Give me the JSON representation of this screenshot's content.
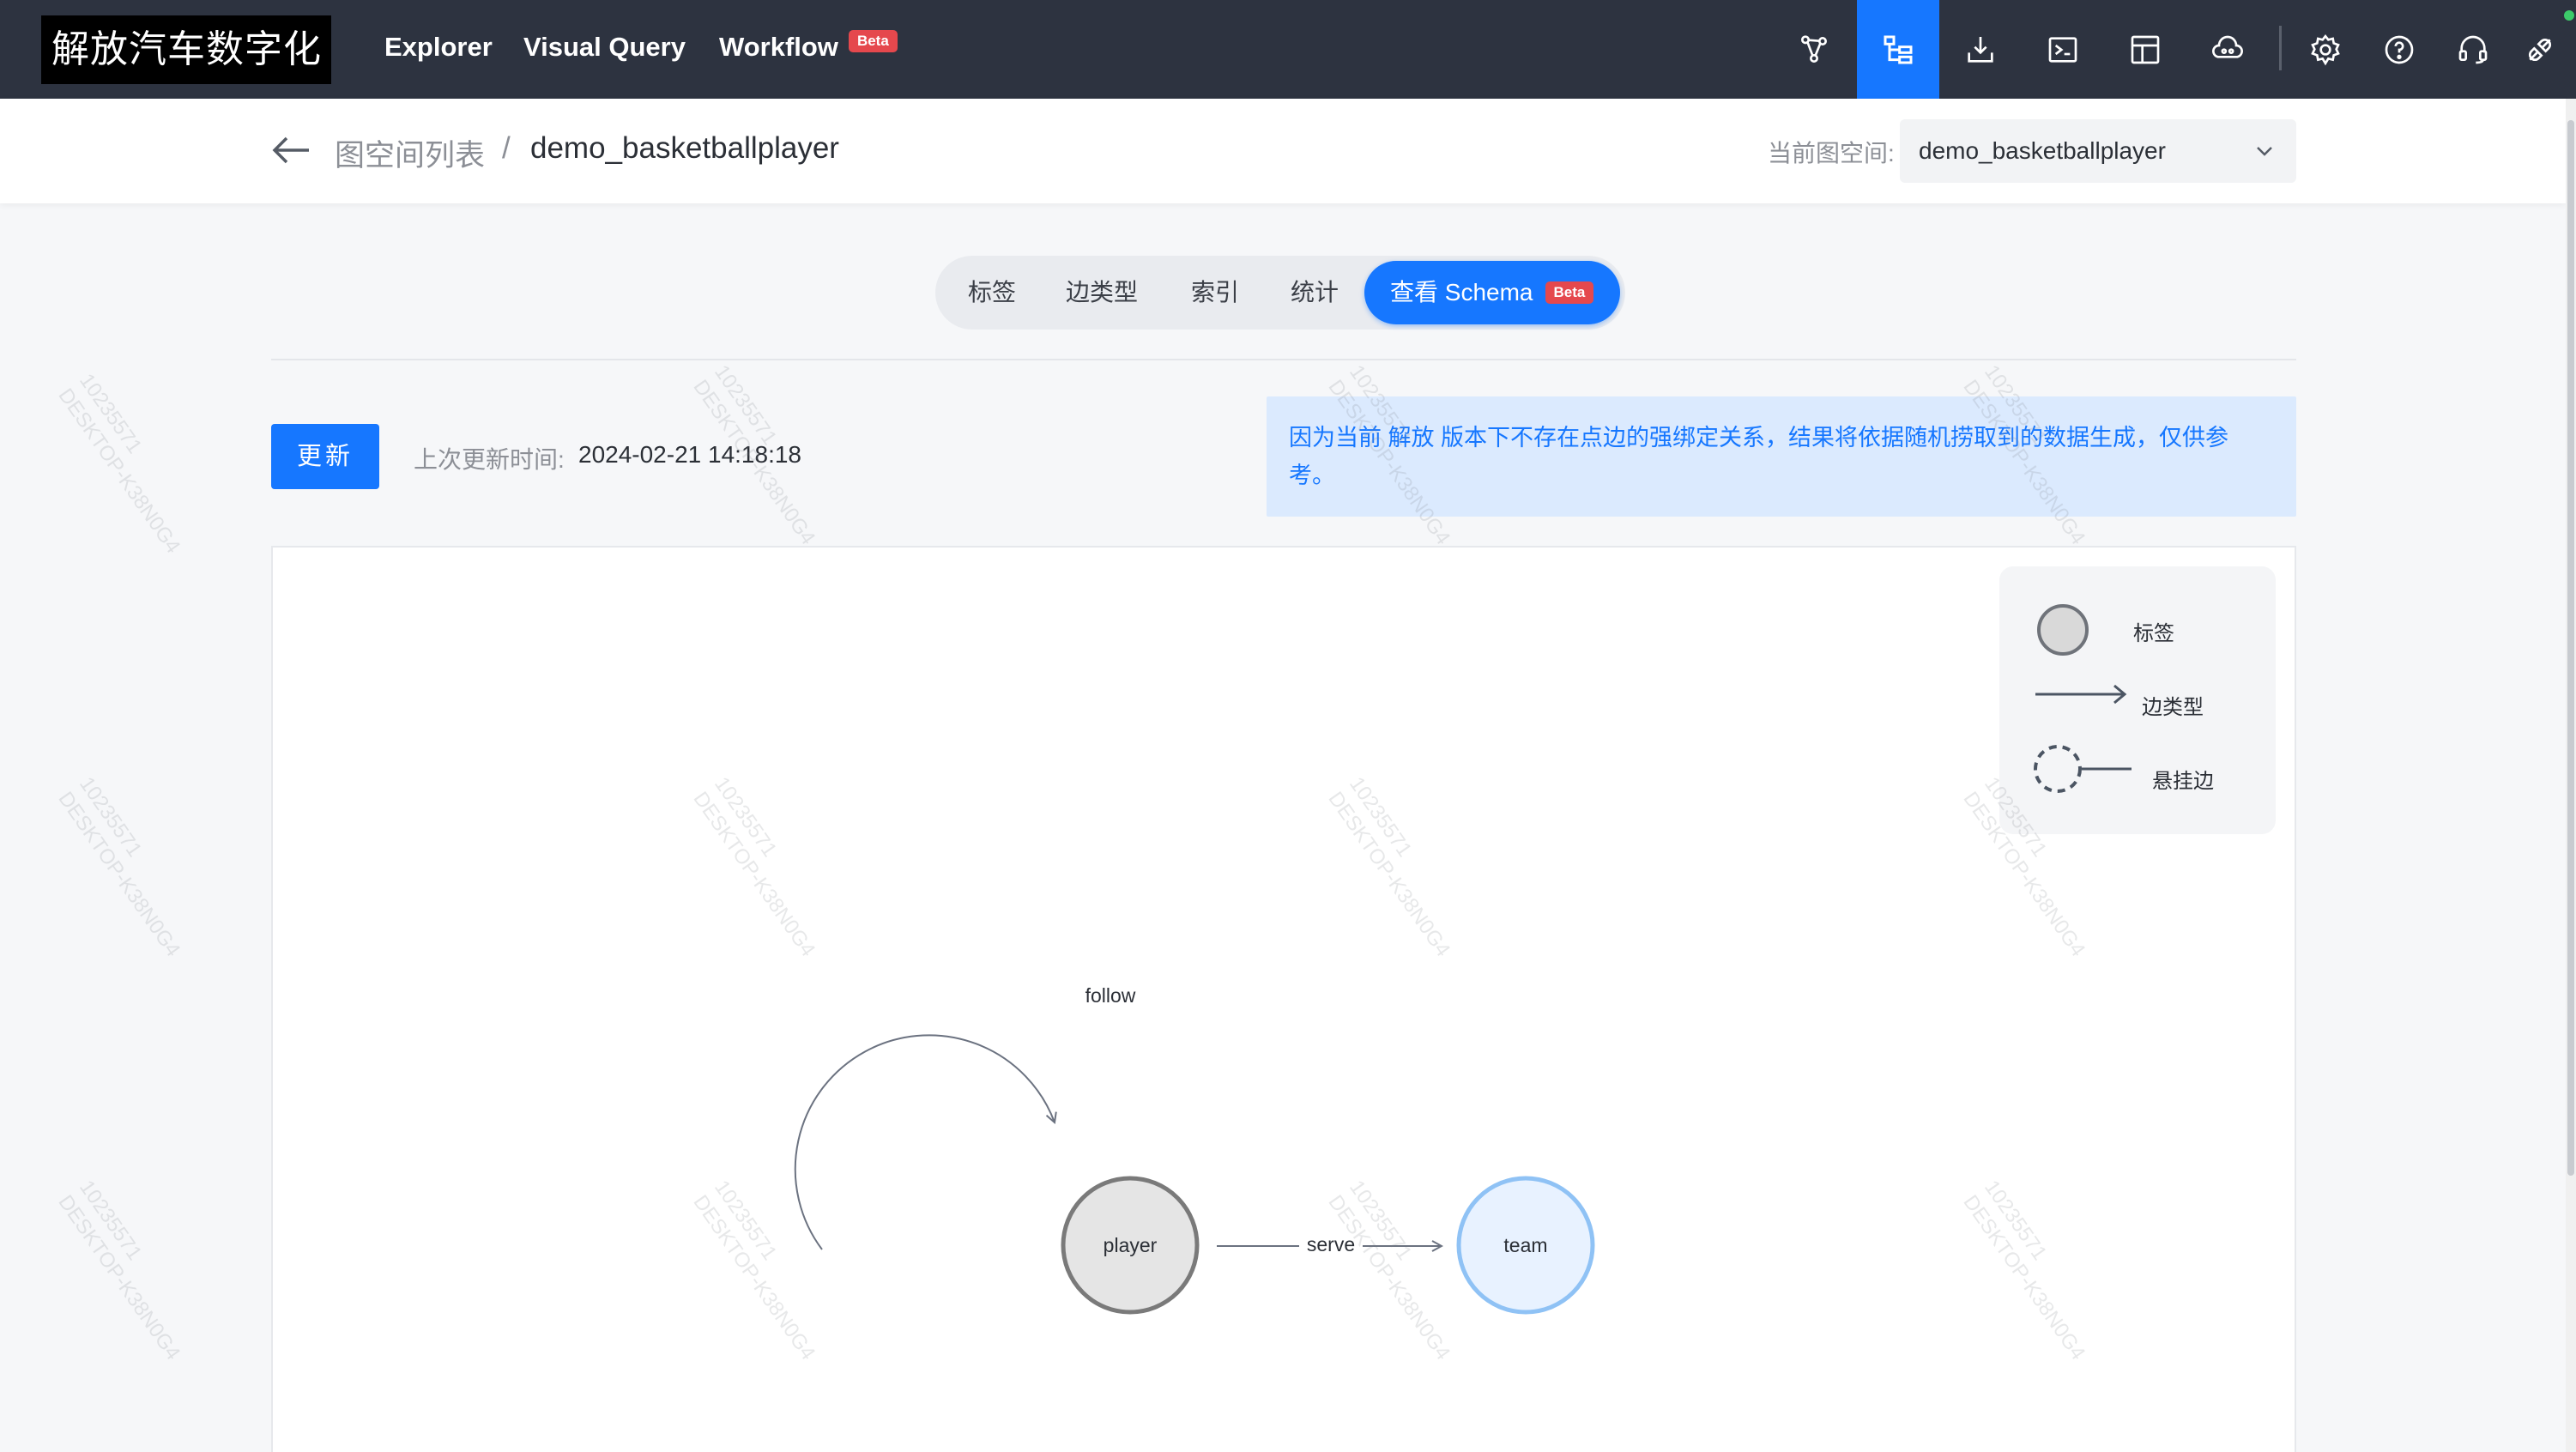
{
  "topbar": {
    "logo_text": "解放汽车数字化",
    "nav": [
      {
        "label": "Explorer"
      },
      {
        "label": "Visual Query"
      },
      {
        "label": "Workflow",
        "badge": "Beta"
      }
    ],
    "tools": [
      {
        "icon": "graph-explore-icon"
      },
      {
        "icon": "schema-icon",
        "active": true
      },
      {
        "icon": "import-icon"
      },
      {
        "icon": "console-icon"
      },
      {
        "icon": "template-icon"
      },
      {
        "icon": "cloud-icon"
      },
      {
        "icon": "settings-icon"
      },
      {
        "icon": "help-icon"
      },
      {
        "icon": "headset-icon"
      },
      {
        "icon": "connection-icon"
      }
    ]
  },
  "breadcrumb": {
    "parent": "图空间列表",
    "separator": "/",
    "current": "demo_basketballplayer"
  },
  "space_selector": {
    "label": "当前图空间:",
    "value": "demo_basketballplayer"
  },
  "tabs": [
    {
      "label": "标签"
    },
    {
      "label": "边类型"
    },
    {
      "label": "索引"
    },
    {
      "label": "统计"
    },
    {
      "label": "查看 Schema",
      "badge": "Beta",
      "active": true
    }
  ],
  "update": {
    "button_label": "更新",
    "time_label": "上次更新时间:",
    "time_value": "2024-02-21 14:18:18"
  },
  "notice": {
    "text": "因为当前 解放 版本下不存在点边的强绑定关系，结果将依据随机捞取到的数据生成，仅供参考。"
  },
  "legend": {
    "tag": "标签",
    "edge_type": "边类型",
    "dangling_edge": "悬挂边"
  },
  "graph": {
    "nodes": [
      {
        "id": "player",
        "label": "player"
      },
      {
        "id": "team",
        "label": "team"
      }
    ],
    "edges": [
      {
        "label": "follow",
        "from": "player",
        "to": "player"
      },
      {
        "label": "serve",
        "from": "player",
        "to": "team"
      }
    ]
  },
  "watermark": {
    "line1": "10235571",
    "line2": "DESKTOP-K38N0G4"
  },
  "colors": {
    "topbar": "#2d3340",
    "accent": "#1677ff",
    "beta": "#e5484d",
    "notice_bg": "#dbeafe"
  }
}
